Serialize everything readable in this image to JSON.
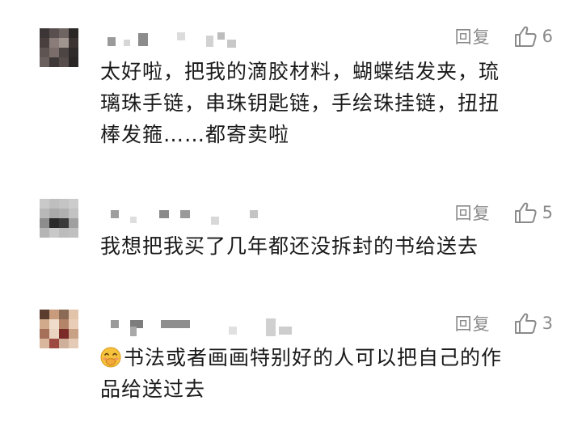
{
  "comments": [
    {
      "reply_label": "回复",
      "like_count": "6",
      "text_lines": [
        "太好啦，把我的滴胶材料，蝴蝶结发夹，琉",
        "璃珠手链，串珠钥匙链，手绘珠挂链，扭扭",
        "棒发箍……都寄卖啦"
      ],
      "avatar_colors": [
        "#3b3536",
        "#5a4f4f",
        "#6e6462",
        "#2c2727",
        "#4a3f3f",
        "#8a7c78",
        "#a19590",
        "#3c3433",
        "#5e5452",
        "#7b6e6a",
        "#4d4444",
        "#2f2a2a",
        "#6a605e",
        "#3e3838",
        "#574d4b",
        "#2a2626"
      ]
    },
    {
      "reply_label": "回复",
      "like_count": "5",
      "text_lines": [
        "我想把我买了几年都还没拆封的书给送去"
      ],
      "avatar_colors": [
        "#c9c9c9",
        "#bfbfbf",
        "#c4c4c4",
        "#cccccc",
        "#b8b8b8",
        "#aaaaaa",
        "#b0b0b0",
        "#c2c2c2",
        "#8d8d8d",
        "#2a2a2a",
        "#3a3a3a",
        "#a0a0a0",
        "#b5b5b5",
        "#c8c8c8",
        "#bcbcbc",
        "#c0c0c0"
      ]
    },
    {
      "reply_label": "回复",
      "like_count": "3",
      "text_lines": [
        "书法或者画画特别好的人可以把自己的作",
        "品给送过去"
      ],
      "emoji": "face-with-hand-over-mouth-emoji",
      "avatar_colors": [
        "#5a3d2f",
        "#c79b7c",
        "#8a6a55",
        "#e2c4ab",
        "#d1a98b",
        "#f0dccb",
        "#b48468",
        "#e9cdb6",
        "#a56f58",
        "#ead3c0",
        "#7a2b28",
        "#c9a286",
        "#d9b79d",
        "#9c4a42",
        "#cfb09a",
        "#e5cbb6"
      ]
    }
  ]
}
